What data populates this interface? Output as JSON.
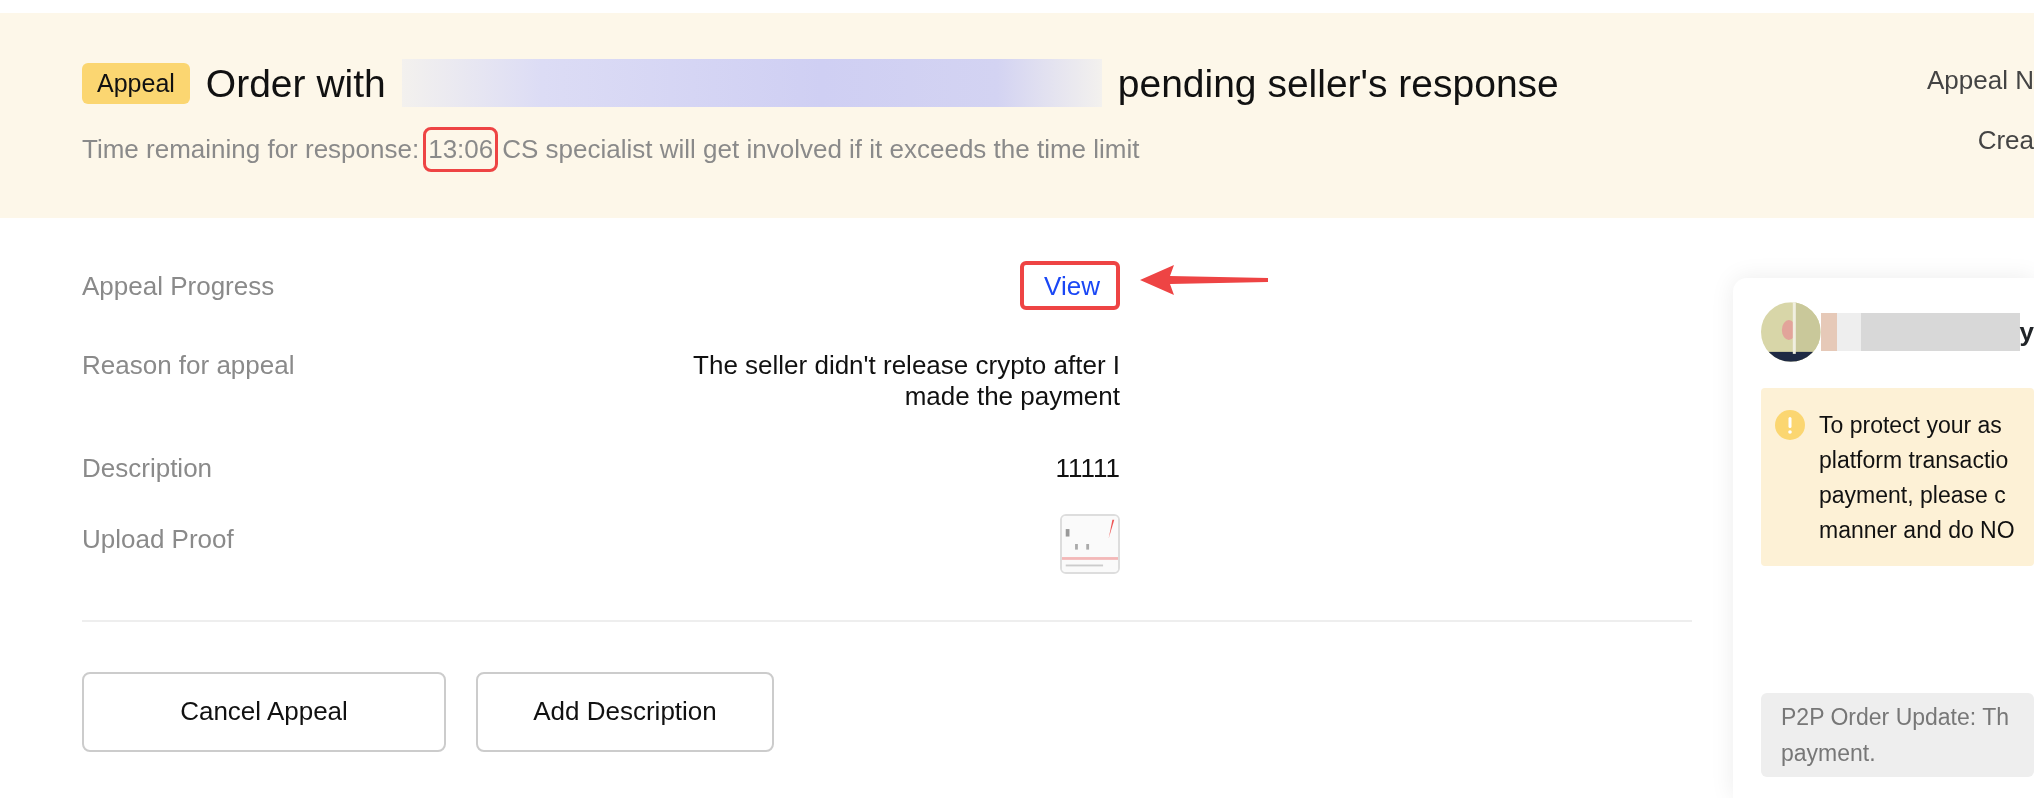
{
  "header": {
    "badge": "Appeal",
    "title_start": "Order with",
    "title_end": "pending seller's response",
    "countdown_label": "Time remaining for response:",
    "countdown": "13:06",
    "countdown_annotated": true,
    "countdown_note": "CS specialist will get involved if it exceeds the time limit",
    "side_lines": [
      "Appeal N",
      "Crea"
    ]
  },
  "details": [
    {
      "kind": "link",
      "label": "Appeal Progress",
      "value": "View",
      "annotated": true
    },
    {
      "kind": "text",
      "label": "Reason for appeal",
      "value": "The seller didn't release crypto after I made the payment"
    },
    {
      "kind": "text",
      "label": "Description",
      "value": "11111"
    },
    {
      "label": "Upload Proof"
    }
  ],
  "buttons": [
    "Cancel Appeal",
    "Add Description"
  ],
  "chat": {
    "name_tail": "y",
    "notice_lines": [
      "To protect your as",
      "platform transactio",
      "payment, please c",
      "manner and do NO"
    ],
    "message": "P2P Order Update: Th",
    "message_end": "payment."
  }
}
